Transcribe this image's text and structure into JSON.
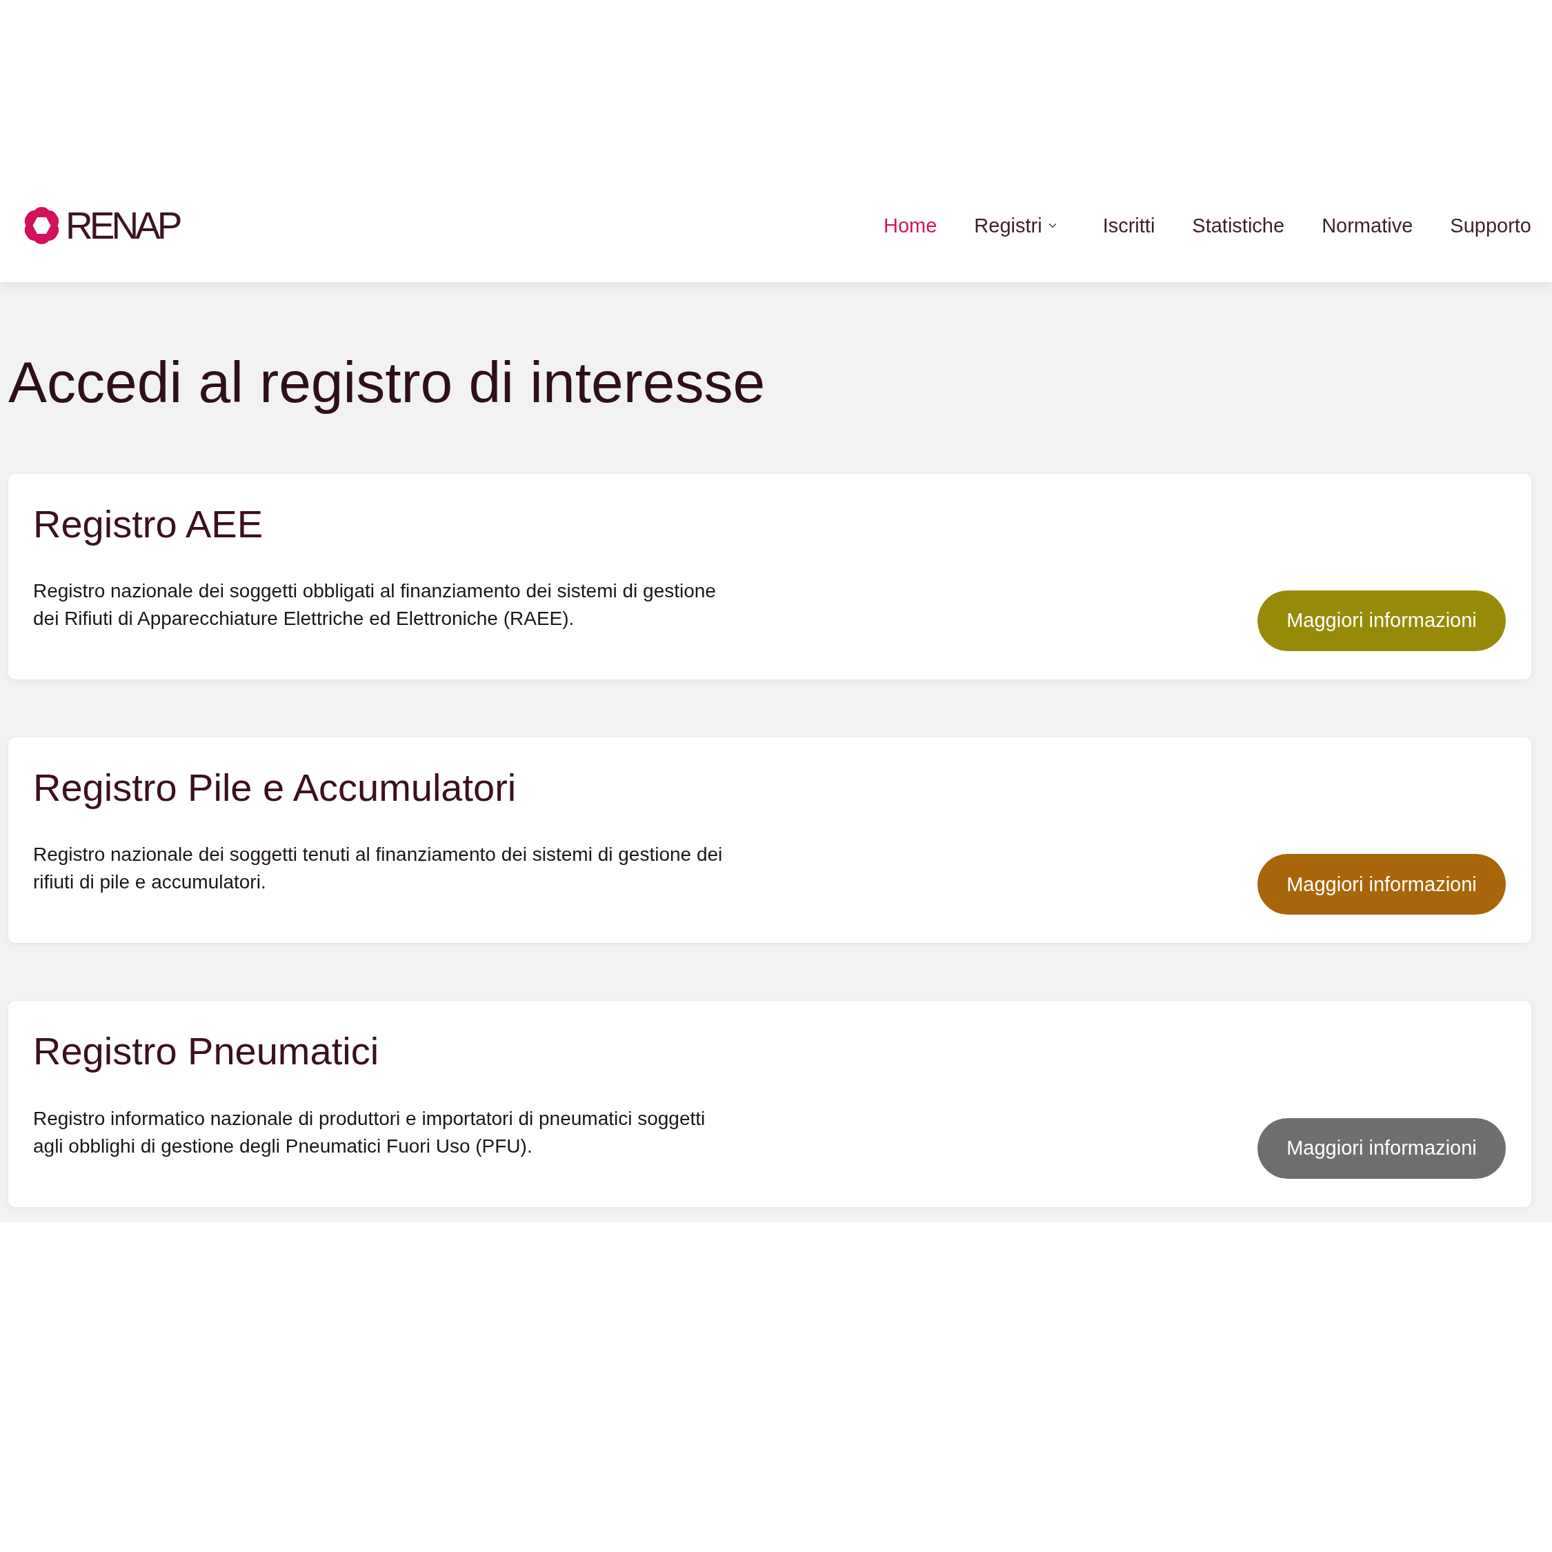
{
  "header": {
    "logo": {
      "text": "RENAP"
    },
    "nav": [
      {
        "label": "Home",
        "selected": true,
        "dropdown": false
      },
      {
        "label": "Registri",
        "selected": false,
        "dropdown": true
      },
      {
        "label": "Iscritti",
        "selected": false,
        "dropdown": false
      },
      {
        "label": "Statistiche",
        "selected": false,
        "dropdown": false
      },
      {
        "label": "Normative",
        "selected": false,
        "dropdown": false
      },
      {
        "label": "Supporto",
        "selected": false,
        "dropdown": false
      }
    ]
  },
  "page": {
    "title": "Accedi al registro di interesse",
    "registries": [
      {
        "title": "Registro AEE",
        "description": "Registro nazionale dei soggetti obbligati al finanziamento dei sistemi di gestione dei Rifiuti di Apparecchiature Elettriche ed Elettroniche (RAEE).",
        "button": "Maggiori informazioni",
        "color": "#978a08"
      },
      {
        "title": "Registro Pile e Accumulatori",
        "description": "Registro nazionale dei soggetti tenuti al finanziamento dei sistemi di gestione dei rifiuti di pile e accumulatori.",
        "button": "Maggiori informazioni",
        "color": "#a8650a"
      },
      {
        "title": "Registro Pneumatici",
        "description": "Registro informatico nazionale di produttori e importatori di pneumatici soggetti agli obblighi di gestione degli Pneumatici Fuori Uso (PFU).",
        "button": "Maggiori informazioni",
        "color": "#6e6e6e"
      }
    ]
  }
}
